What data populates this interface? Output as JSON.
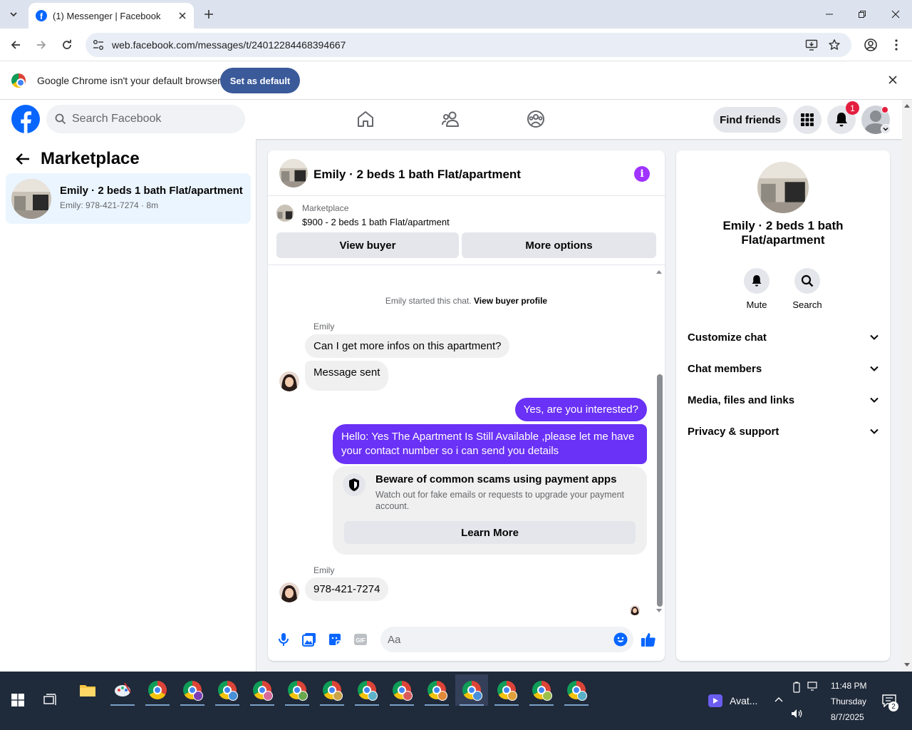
{
  "browser": {
    "tab_title": "(1) Messenger | Facebook",
    "url": "web.facebook.com/messages/t/24012284468394667",
    "infobar_text": "Google Chrome isn't your default browser",
    "set_default_label": "Set as default"
  },
  "fb_header": {
    "search_placeholder": "Search Facebook",
    "find_friends_label": "Find friends",
    "notification_count": "1"
  },
  "sidebar": {
    "title": "Marketplace",
    "conversation": {
      "name": "Emily · 2 beds 1 bath Flat/apartment",
      "preview": "Emily: 978-421-7274 · 8m"
    }
  },
  "chat": {
    "title": "Emily · 2 beds 1 bath Flat/apartment",
    "marketplace_label": "Marketplace",
    "listing": "$900 - 2 beds 1 bath Flat/apartment",
    "view_buyer_label": "View buyer",
    "more_options_label": "More options",
    "started_text": "Emily started this chat.",
    "view_profile_label": "View buyer profile",
    "messages": [
      {
        "sender": "Emily",
        "text": "Can I get more infos on this apartment?"
      },
      {
        "text": "Message sent"
      },
      {
        "text": "Yes, are you interested?"
      },
      {
        "text": "Hello: Yes The Apartment Is Still Available ,please let me have your contact number so i can send you details"
      },
      {
        "sender": "Emily",
        "text": "978-421-7274"
      }
    ],
    "scam_card": {
      "title": "Beware of common scams using payment apps",
      "description": "Watch out for fake emails or requests to upgrade your payment account.",
      "button_label": "Learn More"
    },
    "composer_placeholder": "Aa"
  },
  "details": {
    "name": "Emily · 2 beds 1 bath Flat/apartment",
    "mute_label": "Mute",
    "search_label": "Search",
    "sections": [
      "Customize chat",
      "Chat members",
      "Media, files and links",
      "Privacy & support"
    ]
  },
  "taskbar": {
    "avatar_label": "Avat...",
    "time": "11:48 PM",
    "day": "Thursday",
    "date": "8/7/2025",
    "notification_count": "2"
  },
  "colors": {
    "fb_blue": "#0866ff",
    "outgoing_bubble": "#6a31f6",
    "info_button": "#a033ff",
    "badge_red": "#e41e3f"
  }
}
